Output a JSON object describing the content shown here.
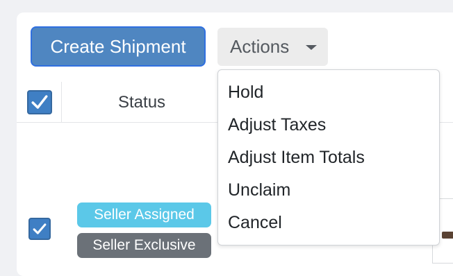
{
  "toolbar": {
    "create_label": "Create Shipment",
    "actions_label": "Actions"
  },
  "actions_menu": {
    "items": [
      {
        "label": "Hold"
      },
      {
        "label": "Adjust Taxes"
      },
      {
        "label": "Adjust Item Totals"
      },
      {
        "label": "Unclaim"
      },
      {
        "label": "Cancel"
      }
    ]
  },
  "table": {
    "header": {
      "status_label": "Status",
      "select_all_checked": true
    },
    "row": {
      "selected": true,
      "badges": [
        {
          "label": "Seller Assigned",
          "color": "#5bc8e8"
        },
        {
          "label": "Seller Exclusive",
          "color": "#6b7178"
        }
      ]
    }
  },
  "theme": {
    "primary": "#4f86c1",
    "checkbox": "#3f7fc4"
  }
}
